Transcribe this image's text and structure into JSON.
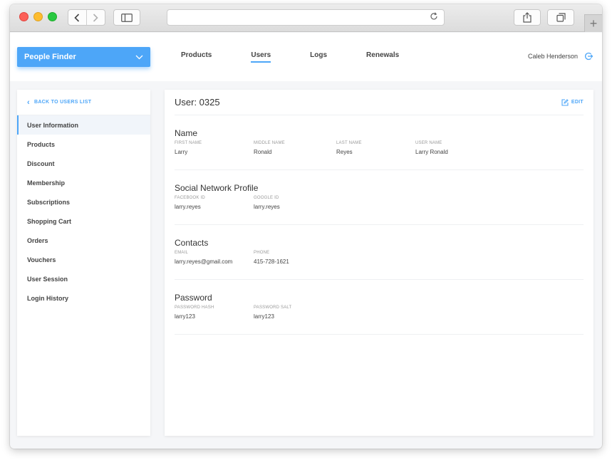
{
  "browser": {
    "url": ""
  },
  "header": {
    "app_selector": "People Finder",
    "nav": [
      {
        "label": "Products",
        "active": false
      },
      {
        "label": "Users",
        "active": true
      },
      {
        "label": "Logs",
        "active": false
      },
      {
        "label": "Renewals",
        "active": false
      }
    ],
    "user_name": "Caleb Henderson"
  },
  "sidebar": {
    "back_label": "BACK TO USERS LIST",
    "items": [
      {
        "label": "User Information",
        "active": true
      },
      {
        "label": "Products",
        "active": false
      },
      {
        "label": "Discount",
        "active": false
      },
      {
        "label": "Membership",
        "active": false
      },
      {
        "label": "Subscriptions",
        "active": false
      },
      {
        "label": "Shopping Cart",
        "active": false
      },
      {
        "label": "Orders",
        "active": false
      },
      {
        "label": "Vouchers",
        "active": false
      },
      {
        "label": "User Session",
        "active": false
      },
      {
        "label": "Login History",
        "active": false
      }
    ]
  },
  "main": {
    "title": "User: 0325",
    "edit_label": "EDIT",
    "sections": [
      {
        "title": "Name",
        "fields": [
          {
            "label": "FIRST NAME",
            "value": "Larry"
          },
          {
            "label": "MIDDLE NAME",
            "value": "Ronald"
          },
          {
            "label": "LAST NAME",
            "value": "Reyes"
          },
          {
            "label": "USER NAME",
            "value": "Larry Ronald"
          }
        ]
      },
      {
        "title": "Social Network Profile",
        "fields": [
          {
            "label": "FACEBOOK ID",
            "value": "larry.reyes"
          },
          {
            "label": "GOOGLE ID",
            "value": "larry.reyes"
          }
        ]
      },
      {
        "title": "Contacts",
        "fields": [
          {
            "label": "EMAIL",
            "value": "larry.reyes@gmail.com"
          },
          {
            "label": "PHONE",
            "value": "415-728-1621"
          }
        ]
      },
      {
        "title": "Password",
        "fields": [
          {
            "label": "PASSWORD HASH",
            "value": "larry123"
          },
          {
            "label": "PASSWORD SALT",
            "value": "larry123"
          }
        ]
      }
    ]
  },
  "colors": {
    "accent": "#4da6f8"
  }
}
